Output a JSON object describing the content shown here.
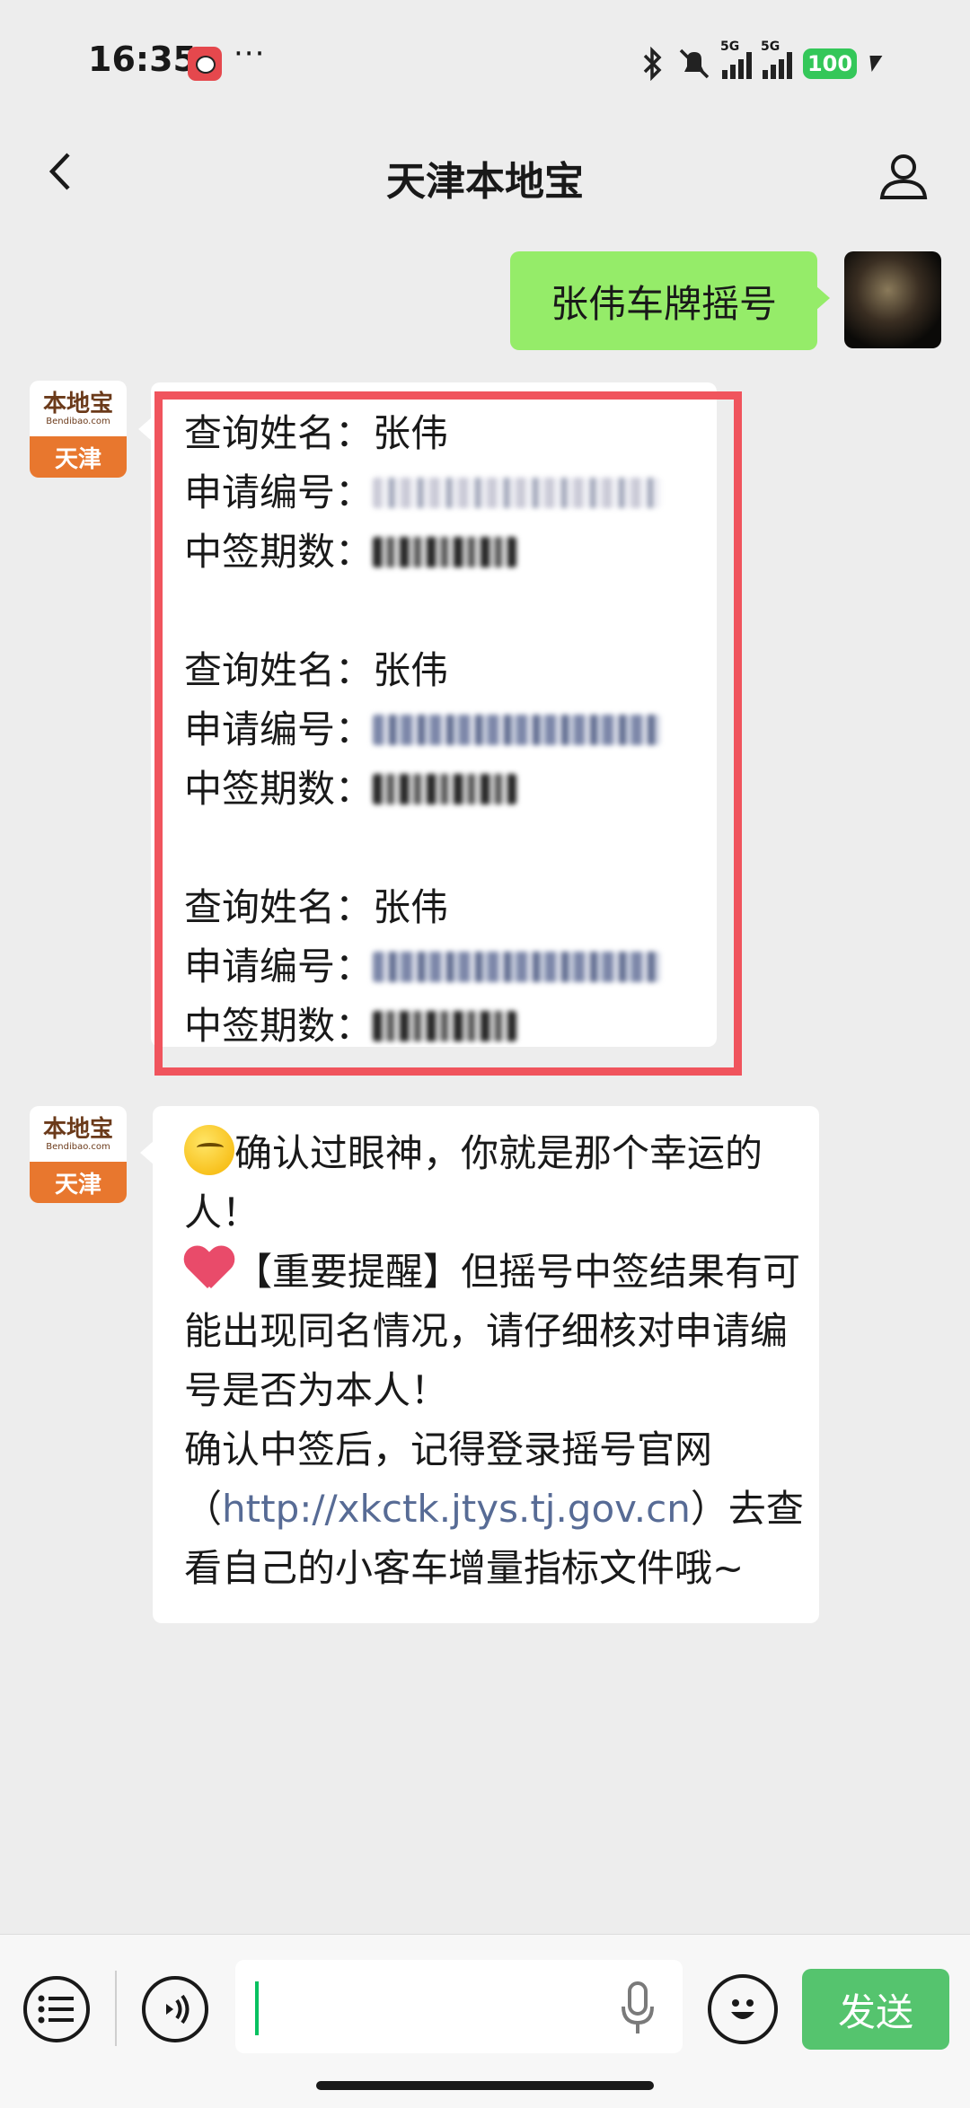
{
  "status_bar": {
    "time": "16:35",
    "dots": "···",
    "network_label_1": "5G",
    "network_label_2": "5G",
    "battery": "100"
  },
  "navbar": {
    "back_icon": "chevron-left-icon",
    "title": "天津本地宝",
    "profile_icon": "person-icon"
  },
  "chat": {
    "outgoing": {
      "text": "张伟车牌摇号"
    },
    "avatar_left": {
      "brand_cn": "本地宝",
      "brand_en": "Bendibao.com",
      "city": "天津"
    },
    "records": [
      {
        "name_label": "查询姓名：",
        "name": "张伟",
        "app_label": "申请编号：",
        "period_label": "中签期数："
      },
      {
        "name_label": "查询姓名：",
        "name": "张伟",
        "app_label": "申请编号：",
        "period_label": "中签期数："
      },
      {
        "name_label": "查询姓名：",
        "name": "张伟",
        "app_label": "申请编号：",
        "period_label": "中签期数："
      }
    ],
    "message": {
      "line1": "确认过眼神，你就是那个幸运的人！",
      "line2": "【重要提醒】但摇号中签结果有可能出现同名情况，请仔细核对申请编号是否为本人！",
      "line3a": "确认中签后，记得登录摇号官网（",
      "link": "http://xkctk.jtys.tj.gov.cn",
      "line3b": "）去查看自己的小客车增量指标文件哦~"
    }
  },
  "input_bar": {
    "send_label": "发送",
    "menu_icon": "list-icon",
    "voice_icon": "voice-icon",
    "mic_icon": "mic-icon",
    "emoji_icon": "smiley-icon"
  },
  "colors": {
    "accent_green": "#95ec69",
    "send_green": "#55c46e",
    "highlight_red": "#f0545d",
    "link_blue": "#576b95"
  }
}
